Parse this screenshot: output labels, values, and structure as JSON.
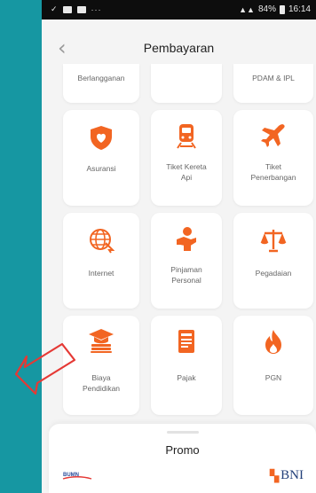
{
  "status": {
    "battery": "84%",
    "time": "16:14"
  },
  "header": {
    "title": "Pembayaran"
  },
  "top_row": [
    "Berlangganan",
    "",
    "PDAM & IPL"
  ],
  "grid": [
    {
      "label": "Asuransi",
      "icon": "shield-heart-icon"
    },
    {
      "label": "Tiket Kereta Api",
      "icon": "train-icon"
    },
    {
      "label": "Tiket Penerbangan",
      "icon": "airplane-icon"
    },
    {
      "label": "Internet",
      "icon": "globe-icon"
    },
    {
      "label": "Pinjaman Personal",
      "icon": "loan-hand-icon"
    },
    {
      "label": "Pegadaian",
      "icon": "scale-icon"
    },
    {
      "label": "Biaya Pendidikan",
      "icon": "graduation-cap-icon"
    },
    {
      "label": "Pajak",
      "icon": "tax-document-icon"
    },
    {
      "label": "PGN",
      "icon": "flame-icon"
    }
  ],
  "promo": {
    "title": "Promo"
  },
  "logos": {
    "left": "BUMN",
    "right": "BNI"
  },
  "colors": {
    "accent": "#f26522",
    "background": "#1697a2",
    "arrow": "#e53935"
  }
}
